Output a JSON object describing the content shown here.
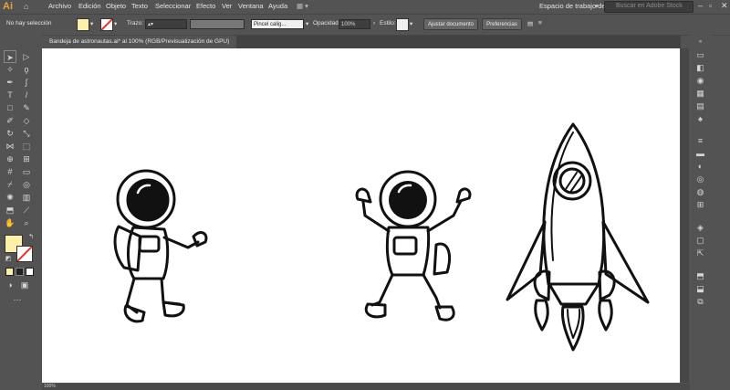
{
  "app": {
    "logo": "Ai"
  },
  "menus": [
    "Archivo",
    "Edición",
    "Objeto",
    "Texto",
    "Seleccionar",
    "Efecto",
    "Ver",
    "Ventana",
    "Ayuda"
  ],
  "workspace": {
    "label": "Espacio de trabajo de Choni",
    "search_placeholder": "Buscar en Adobe Stock"
  },
  "control": {
    "selection_status": "No hay selección",
    "stroke_label": "Trazo:",
    "brush_label": "Pincel calig...",
    "opacity_label": "Opacidad:",
    "opacity_value": "100%",
    "style_label": "Estilo:",
    "adjust_doc": "Ajustar documento",
    "prefs": "Preferencias",
    "fill_color": "#fdf0a8"
  },
  "document": {
    "tab_title": "Bandeja de astronautas.ai* al 100% (RGB/Previsualización de GPU)"
  },
  "status": {
    "zoom": "100%"
  },
  "artwork": [
    "astronaut-walking",
    "astronaut-cheering",
    "rocket"
  ]
}
